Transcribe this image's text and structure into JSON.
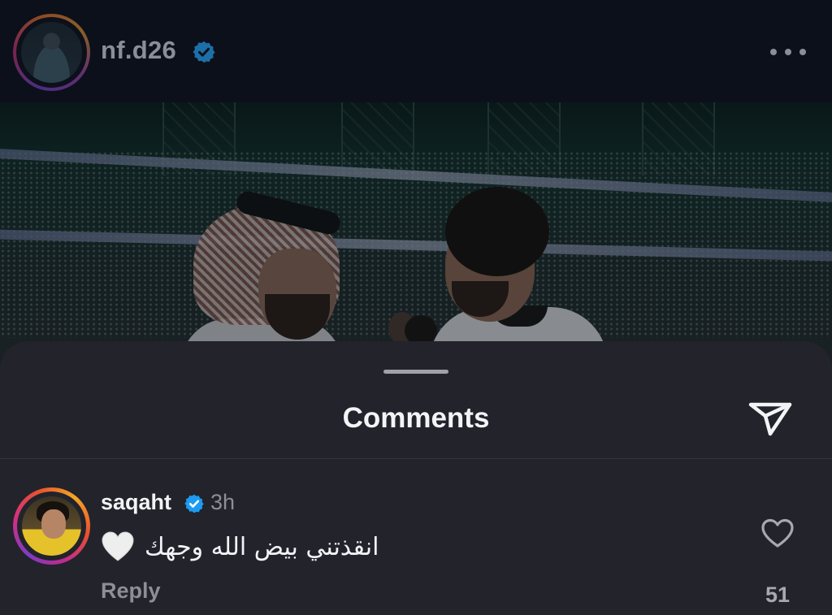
{
  "post_header": {
    "username": "nf.d26",
    "verified": true,
    "avatar_icon": "profile-photo",
    "more_icon": "more-horizontal-icon"
  },
  "post_image": {
    "icon": "photo-stadium-two-men"
  },
  "comments_sheet": {
    "title": "Comments",
    "send_icon": "paper-plane-icon"
  },
  "comments": [
    {
      "username": "saqaht",
      "verified": true,
      "time": "3h",
      "text": "انقذتني بيض الله وجهك",
      "emoji": "white-heart",
      "reply_label": "Reply",
      "like_count": "51"
    }
  ],
  "colors": {
    "verified_blue": "#1d9bf0",
    "sheet_bg": "#22232b",
    "header_bg": "#0c101a"
  }
}
